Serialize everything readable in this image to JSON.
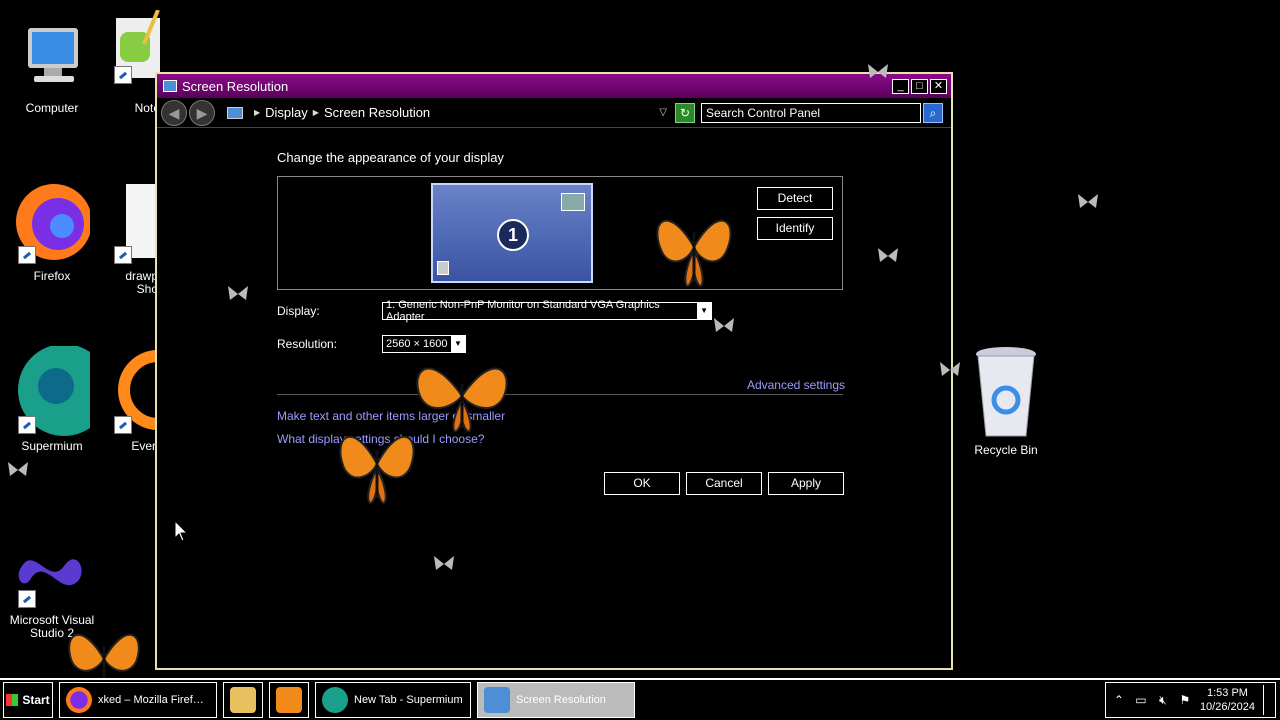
{
  "desktop_icons": [
    {
      "id": "computer",
      "label": "Computer"
    },
    {
      "id": "notepad",
      "label": "Note"
    },
    {
      "id": "firefox",
      "label": "Firefox"
    },
    {
      "id": "drawpile",
      "label": "drawp\nSho"
    },
    {
      "id": "supermium",
      "label": "Supermium"
    },
    {
      "id": "everything",
      "label": "Ever"
    },
    {
      "id": "visualstudio",
      "label": "Microsoft Visual\nStudio 2"
    },
    {
      "id": "recyclebin",
      "label": "Recycle Bin"
    }
  ],
  "window": {
    "title": "Screen Resolution",
    "controls": {
      "minimize": "_",
      "maximize": "□",
      "close": "✕"
    },
    "nav": {
      "back": "◀",
      "forward": "▶"
    },
    "breadcrumb": [
      "Display",
      "Screen Resolution"
    ],
    "search_placeholder": "Search Control Panel",
    "heading": "Change the appearance of your display",
    "monitor_number": "1",
    "detect_label": "Detect",
    "identify_label": "Identify",
    "display_label": "Display:",
    "display_value": "1. Generic Non-PnP Monitor on Standard VGA Graphics Adapter",
    "resolution_label": "Resolution:",
    "resolution_value": "2560 × 1600",
    "advanced_link": "Advanced settings",
    "link_text_size": "Make text and other items larger or smaller",
    "link_help": "What display settings should I choose?",
    "ok_label": "OK",
    "cancel_label": "Cancel",
    "apply_label": "Apply"
  },
  "taskbar": {
    "start_label": "Start",
    "tasks": [
      {
        "label": "xked – Mozilla Firef…",
        "active": false
      },
      {
        "label": "",
        "active": false
      },
      {
        "label": "",
        "active": false
      },
      {
        "label": "New Tab - Supermium",
        "active": false
      },
      {
        "label": "Screen Resolution",
        "active": true
      }
    ],
    "tray_chevron": "⌃",
    "clock_time": "1:53 PM",
    "clock_date": "10/26/2024"
  },
  "colors": {
    "titlebar": "#7a007a",
    "link": "#9c9cff",
    "window_border": "#e8e4a8",
    "butterfly": "#f08a1a"
  }
}
